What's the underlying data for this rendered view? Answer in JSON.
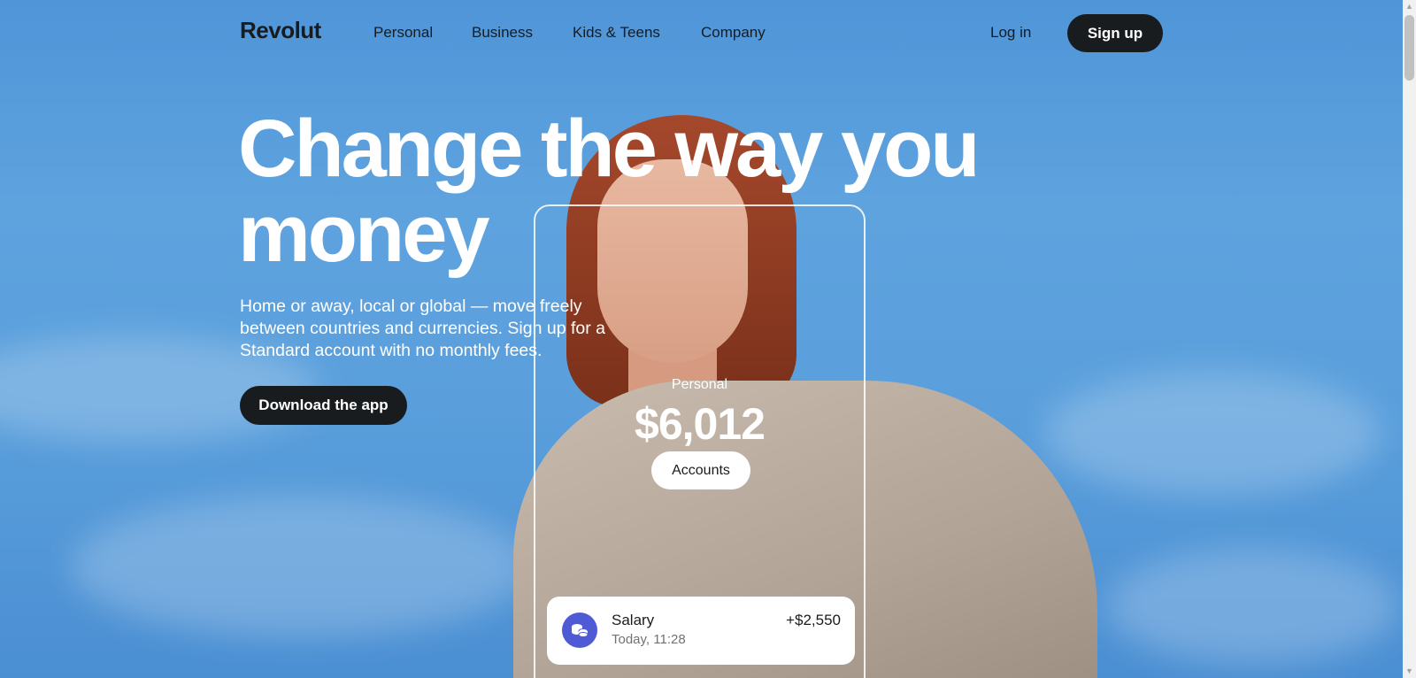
{
  "nav": {
    "logo": "Revolut",
    "links": [
      "Personal",
      "Business",
      "Kids & Teens",
      "Company"
    ],
    "login": "Log in",
    "signup": "Sign up"
  },
  "hero": {
    "headline": "Change the way you money",
    "subtext": "Home or away, local or global — move freely between countries and currencies. Sign up for a Standard account with no monthly fees.",
    "cta": "Download the app"
  },
  "phone": {
    "account_label": "Personal",
    "balance": "$6,012",
    "accounts_button": "Accounts",
    "transaction": {
      "title": "Salary",
      "time": "Today, 11:28",
      "amount": "+$2,550",
      "icon": "coins-icon"
    }
  },
  "colors": {
    "sky": "#5ea3de",
    "dark": "#191c1f",
    "accent": "#4f5bd5",
    "white": "#ffffff"
  }
}
